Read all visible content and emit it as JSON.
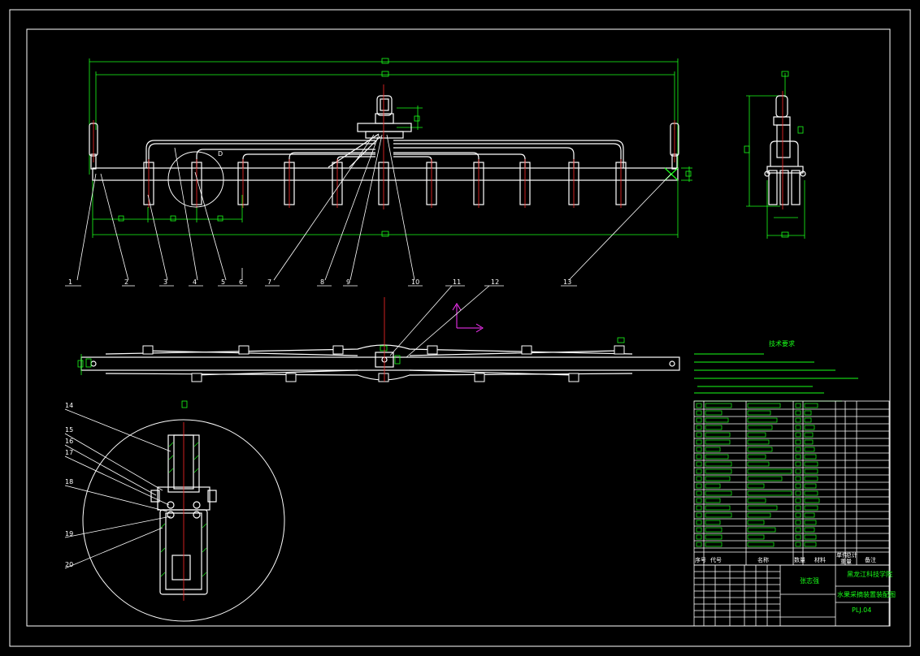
{
  "drawing": {
    "colors": {
      "background": "#000000",
      "outline": "#ffffff",
      "centerline": "#ff2a2a",
      "dimension": "#19ff19",
      "axis": "#ff33ff",
      "text": "#19ff19"
    },
    "callouts_main": [
      "1",
      "2",
      "3",
      "4",
      "5",
      "6",
      "7",
      "8",
      "9",
      "10",
      "11",
      "12",
      "13"
    ],
    "callouts_detail": [
      "14",
      "15",
      "16",
      "17",
      "18",
      "19",
      "20"
    ],
    "detail_marker": "D",
    "title_block": {
      "school": "黑龙江科技学院",
      "drawing_name": "水果采摘装置装配图",
      "drawing_number": "PLJ.04",
      "drawn_by": "张志强"
    },
    "bom_headers": {
      "seq": "序号",
      "code": "代号",
      "name": "名称",
      "qty": "数量",
      "material": "材料",
      "unit_weight": "单件",
      "total_weight": "总计",
      "weight": "重量",
      "remark": "备注"
    },
    "tech_requirements_title": "技术要求"
  }
}
